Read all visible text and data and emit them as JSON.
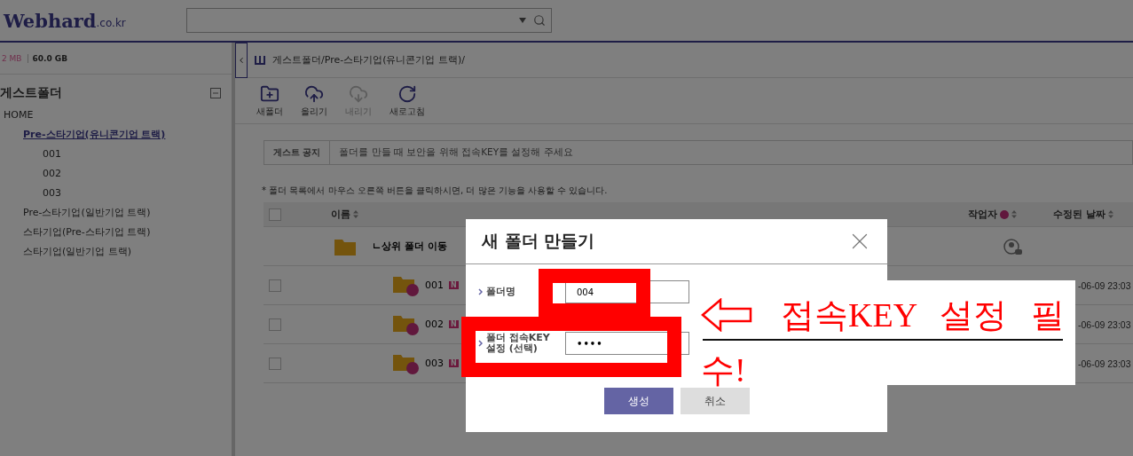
{
  "header": {
    "logo": "Webhard",
    "logo_suffix": ".co.kr"
  },
  "sidebar": {
    "usage_used": "2 MB",
    "usage_total": "60.0 GB",
    "root": "게스트폴더",
    "tree": [
      {
        "label": "HOME",
        "selected": false,
        "children": [
          {
            "label": "Pre-스타기업(유니콘기업 트랙)",
            "selected": true,
            "children": [
              {
                "label": "001",
                "selected": false
              },
              {
                "label": "002",
                "selected": false
              },
              {
                "label": "003",
                "selected": false
              }
            ]
          },
          {
            "label": "Pre-스타기업(일반기업 트랙)",
            "selected": false
          },
          {
            "label": "스타기업(Pre-스타기업 트랙)",
            "selected": false
          },
          {
            "label": "스타기업(일반기업 트랙)",
            "selected": false
          }
        ]
      }
    ]
  },
  "breadcrumb": "게스트폴더/Pre-스타기업(유니콘기업 트랙)/",
  "toolbar": [
    {
      "label": "새폴더",
      "kind": "new-folder",
      "disabled": false
    },
    {
      "label": "올리기",
      "kind": "upload",
      "disabled": false
    },
    {
      "label": "내리기",
      "kind": "download",
      "disabled": true
    },
    {
      "label": "새로고침",
      "kind": "refresh",
      "disabled": false
    }
  ],
  "notice": {
    "label": "게스트 공지",
    "text": "폴더를 만들 때 보안을 위해 접속KEY를 설정해 주세요"
  },
  "hint": "* 폴더 목록에서 마우스 오른쪽 버튼을 클릭하시면, 더 많은 기능을 사용할 수 있습니다.",
  "table": {
    "select_all_checked": false,
    "columns": [
      "이름",
      "작업자",
      "수정된 날짜"
    ],
    "parent_row": "ㄴ상위 폴더 이동",
    "rows": [
      {
        "name": "001",
        "badge": "N",
        "date": "-06-09 23:03",
        "checked": false
      },
      {
        "name": "002",
        "badge": "N",
        "date": "-06-09 23:03",
        "checked": false
      },
      {
        "name": "003",
        "badge": "N",
        "date": "-06-09 23:03",
        "checked": false
      }
    ]
  },
  "dialog": {
    "title": "새 폴더 만들기",
    "fields": [
      {
        "label": "폴더명",
        "value": "004",
        "kind": "text"
      },
      {
        "label": "폴더 접속KEY 설정 (선택)",
        "value": "••••",
        "kind": "password"
      }
    ],
    "buttons": [
      {
        "label": "생성",
        "kind": "primary"
      },
      {
        "label": "취소",
        "kind": "secondary"
      }
    ]
  },
  "callout": {
    "lines": [
      "접속KEY 설정 필",
      "수!"
    ]
  }
}
